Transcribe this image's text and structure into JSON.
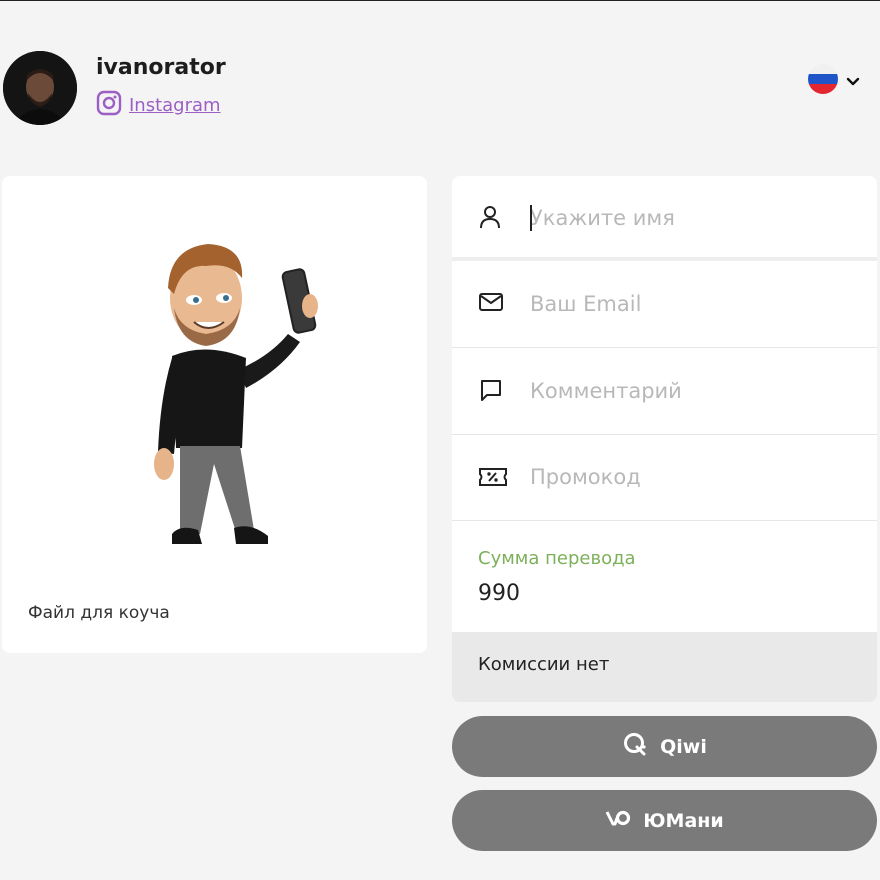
{
  "header": {
    "username": "ivanorator",
    "social_link": "Instagram",
    "language_icon": "russia-flag-icon"
  },
  "product": {
    "caption": "Файл для коуча"
  },
  "form": {
    "name_placeholder": "Укажите имя",
    "email_placeholder": "Ваш Email",
    "comment_placeholder": "Комментарий",
    "promo_placeholder": "Промокод",
    "amount_label": "Сумма перевода",
    "amount_value": "990",
    "commission_text": "Комиссии нет"
  },
  "payment": {
    "qiwi_label": "Qiwi",
    "yoomoney_label": "ЮМани"
  },
  "colors": {
    "background": "#f4f4f4",
    "instagram_link": "#9b5fc6",
    "amount_label": "#7db05a",
    "button": "#7a7a7a"
  }
}
